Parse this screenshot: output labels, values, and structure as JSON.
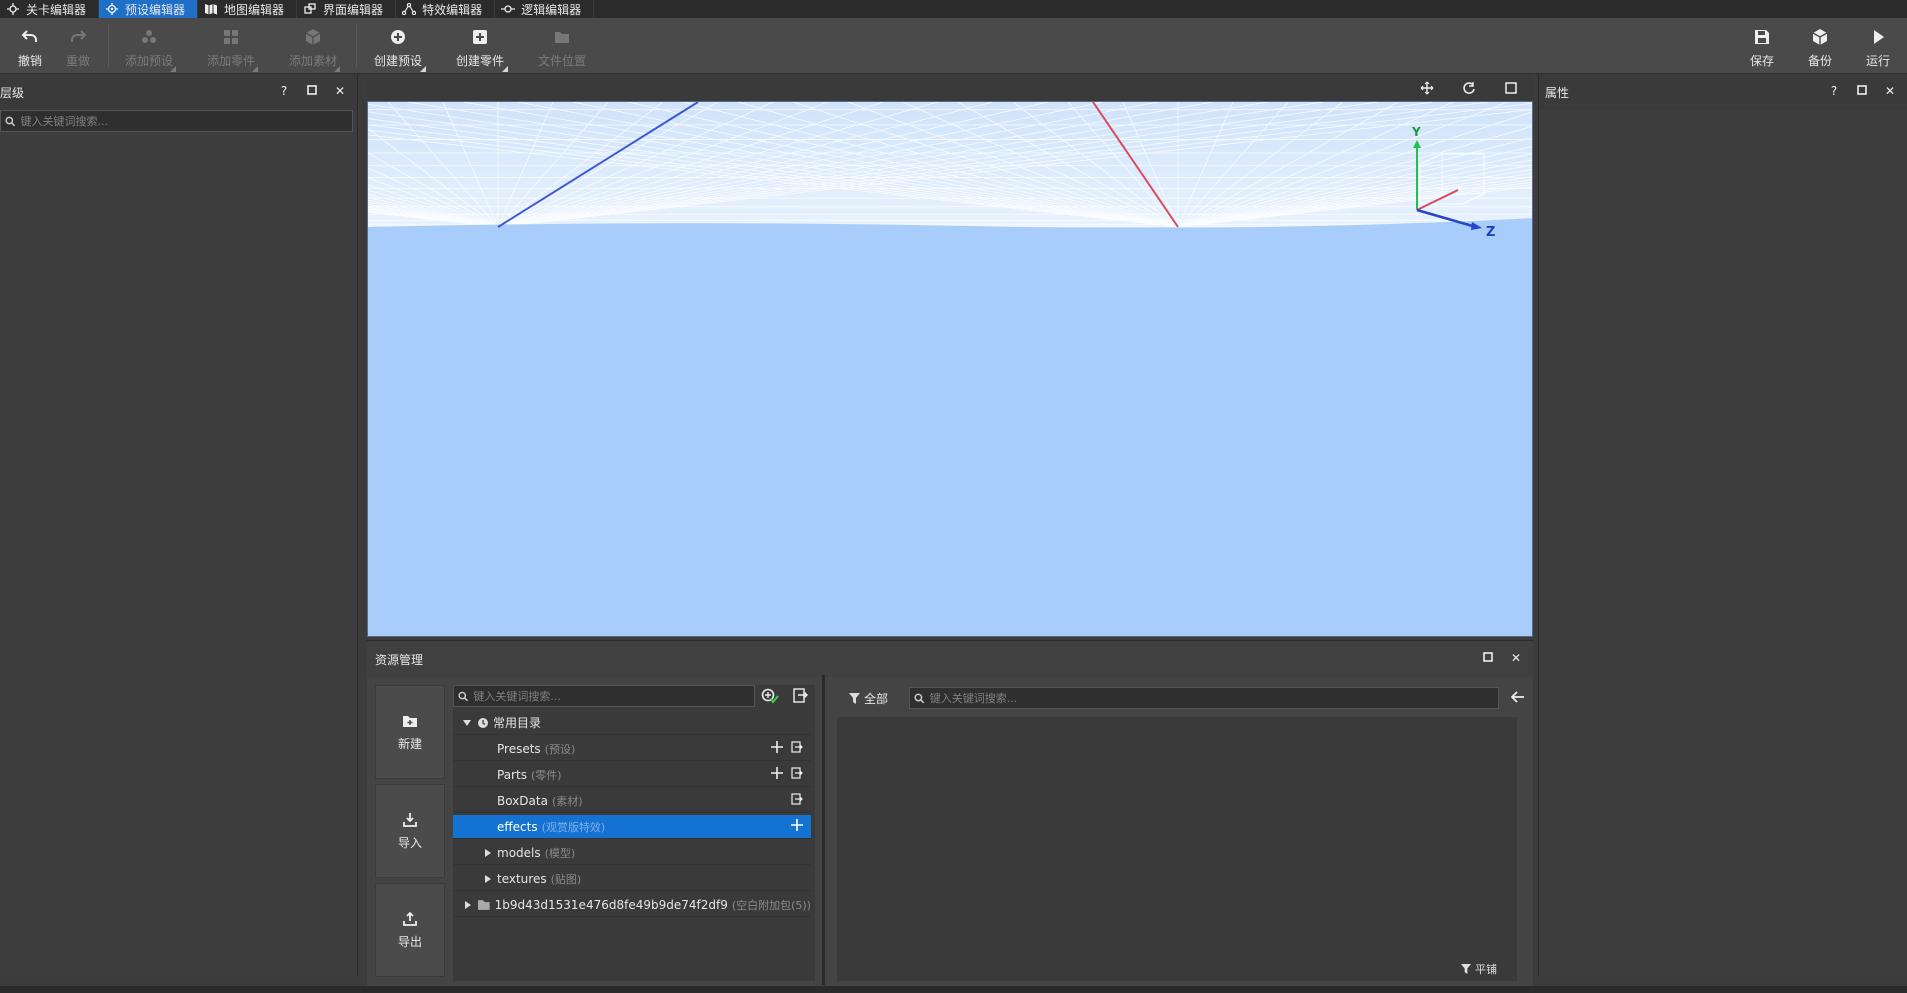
{
  "tabs": [
    {
      "label": "关卡编辑器",
      "icon": "level-editor-icon",
      "active": false
    },
    {
      "label": "预设编辑器",
      "icon": "preset-editor-icon",
      "active": true
    },
    {
      "label": "地图编辑器",
      "icon": "map-editor-icon",
      "active": false
    },
    {
      "label": "界面编辑器",
      "icon": "ui-editor-icon",
      "active": false
    },
    {
      "label": "特效编辑器",
      "icon": "effect-editor-icon",
      "active": false
    },
    {
      "label": "逻辑编辑器",
      "icon": "logic-editor-icon",
      "active": false
    }
  ],
  "toolbar": {
    "undo": "撤销",
    "redo": "重做",
    "add_preset": "添加预设",
    "add_part": "添加零件",
    "add_material": "添加素材",
    "create_preset": "创建预设",
    "create_part": "创建零件",
    "file_location": "文件位置",
    "save": "保存",
    "backup": "备份",
    "run": "运行"
  },
  "hierarchy": {
    "title": "层级",
    "search_placeholder": "键入关键词搜索..."
  },
  "properties": {
    "title": "属性"
  },
  "panel_controls": {
    "help": "?",
    "close": "✕"
  },
  "viewport": {
    "background": "#a9cdfa",
    "axis_y": "Y",
    "axis_z": "Z"
  },
  "resources": {
    "title": "资源管理",
    "side": {
      "new": "新建",
      "import": "导入",
      "export": "导出"
    },
    "tree_search_placeholder": "键入关键词搜索...",
    "tree": {
      "root": "常用目录",
      "items": [
        {
          "name": "Presets",
          "sub": "(预设)"
        },
        {
          "name": "Parts",
          "sub": "(零件)"
        },
        {
          "name": "BoxData",
          "sub": "(素材)"
        },
        {
          "name": "effects",
          "sub": "(观赏版特效)"
        },
        {
          "name": "models",
          "sub": "(模型)"
        },
        {
          "name": "textures",
          "sub": "(贴图)"
        }
      ],
      "package": {
        "name": "1b9d43d1531e476d8fe49b9de74f2df9",
        "sub": "(空白附加包(5))"
      }
    },
    "filter_label": "全部",
    "file_search_placeholder": "键入关键词搜索...",
    "tile_label": "平铺"
  }
}
